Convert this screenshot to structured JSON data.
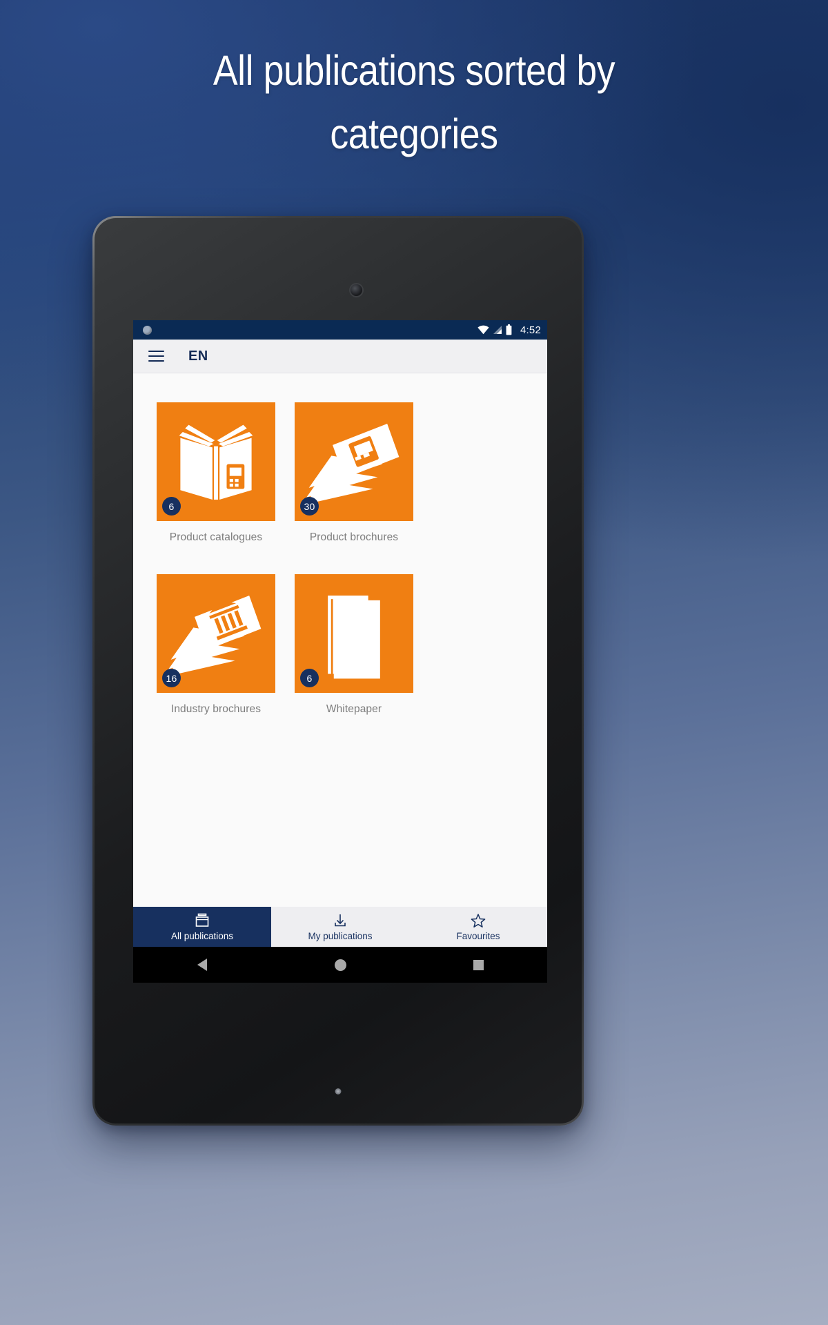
{
  "promo": {
    "headline": "All publications sorted by\ncategories"
  },
  "colors": {
    "accent_orange": "#f07f12",
    "brand_navy": "#17305f",
    "statusbar_navy": "#0a2a54",
    "screen_bg": "#fafafa"
  },
  "status_bar": {
    "time": "4:52",
    "icons": [
      "wifi-icon",
      "cellular-signal-icon",
      "battery-icon"
    ]
  },
  "toolbar": {
    "menu_icon": "hamburger-menu-icon",
    "language": "EN"
  },
  "categories": [
    {
      "label": "Product catalogues",
      "count": "6",
      "art": "open-book"
    },
    {
      "label": "Product brochures",
      "count": "30",
      "art": "brochure-stack"
    },
    {
      "label": "Industry brochures",
      "count": "16",
      "art": "industry-stack"
    },
    {
      "label": "Whitepaper",
      "count": "6",
      "art": "document-sheet"
    }
  ],
  "tabs": [
    {
      "label": "All publications",
      "icon": "briefcase-icon",
      "active": true
    },
    {
      "label": "My publications",
      "icon": "download-icon",
      "active": false
    },
    {
      "label": "Favourites",
      "icon": "star-icon",
      "active": false
    }
  ],
  "android_nav": {
    "back": "back-triangle-icon",
    "home": "home-circle-icon",
    "recents": "recents-square-icon"
  }
}
